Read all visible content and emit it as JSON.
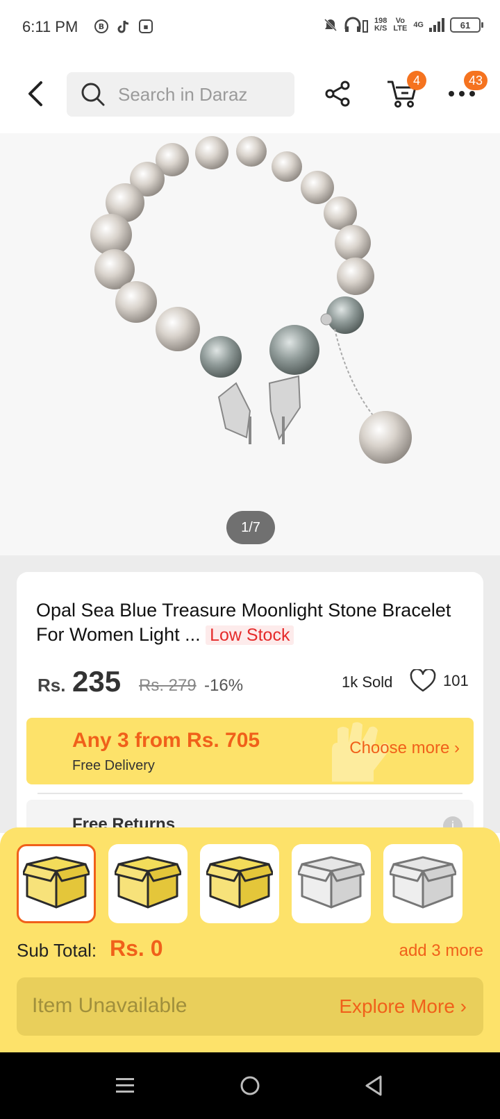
{
  "status_bar": {
    "time": "6:11 PM",
    "net_speed_value": "198",
    "net_speed_unit": "K/S",
    "volte": "Vo LTE",
    "network": "4G",
    "battery": "61"
  },
  "header": {
    "search_placeholder": "Search in Daraz",
    "cart_badge": "4",
    "more_badge": "43"
  },
  "gallery": {
    "page_indicator": "1/7"
  },
  "product": {
    "title": "Opal Sea Blue Treasure Moonlight Stone Bracelet For Women Light ...",
    "stock_label": "Low Stock",
    "currency": "Rs.",
    "price": "235",
    "old_price": "Rs. 279",
    "discount": "-16%",
    "sold": "1k Sold",
    "wishlist_count": "101"
  },
  "promo": {
    "title": "Any 3 from Rs. 705",
    "subtitle": "Free Delivery",
    "choose_more": "Choose more"
  },
  "returns": {
    "label": "Free Returns"
  },
  "bundle": {
    "slots": [
      "filled",
      "filled",
      "filled",
      "empty",
      "empty"
    ],
    "subtotal_label": "Sub Total:",
    "subtotal_value": "Rs. 0",
    "add_more": "add 3 more",
    "unavailable": "Item Unavailable",
    "explore": "Explore More"
  },
  "colors": {
    "accent": "#f0601a",
    "badge": "#f5731f",
    "panel": "#fde26a",
    "low_stock": "#e52b2b"
  }
}
